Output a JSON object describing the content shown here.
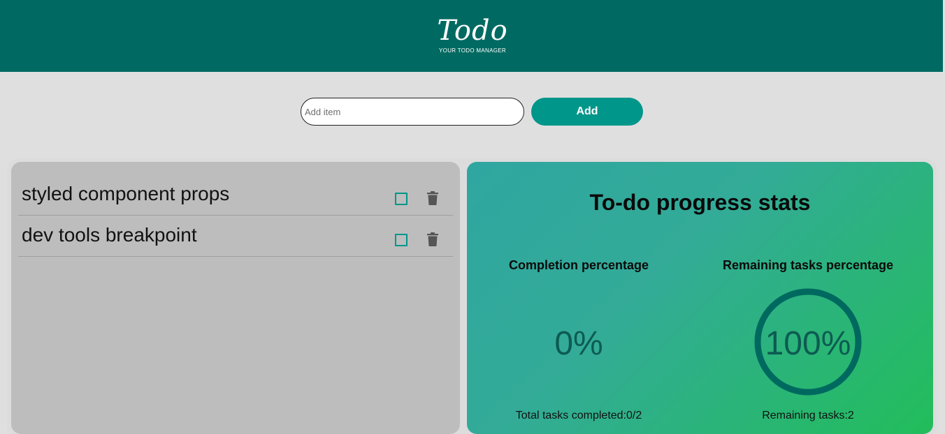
{
  "header": {
    "logo": "Todo",
    "subtitle": "YOUR TODO MANAGER"
  },
  "add_form": {
    "placeholder": "Add item",
    "value": "",
    "button_label": "Add"
  },
  "todos": [
    {
      "text": "styled component props",
      "checked": false
    },
    {
      "text": "dev tools breakpoint",
      "checked": false
    }
  ],
  "stats": {
    "title": "To-do progress stats",
    "completion": {
      "label": "Completion percentage",
      "value": "0%",
      "fraction": 0,
      "footer": "Total tasks completed:0/2"
    },
    "remaining": {
      "label": "Remaining tasks percentage",
      "value": "100%",
      "fraction": 1,
      "footer": "Remaining tasks:2"
    }
  },
  "colors": {
    "header_bg": "#006a62",
    "accent": "#00968a",
    "ring": "#00695f"
  }
}
